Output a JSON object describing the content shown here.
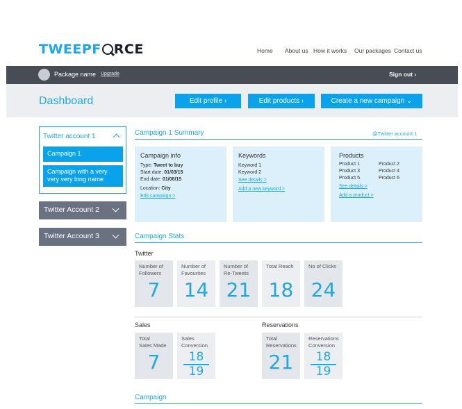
{
  "logo": {
    "part1": "TWEEPF",
    "part2": "RCE"
  },
  "topnav": [
    "Home",
    "About us",
    "How it works",
    "Our packages",
    "Contact us"
  ],
  "bar": {
    "package": "Package name",
    "upgrade": "Upgrade",
    "signout": "Sign out ›"
  },
  "header": {
    "title": "Dashboard",
    "edit_profile": "Edit profile ›",
    "edit_products": "Edit products ›",
    "create": "Create a new campaign ⌄"
  },
  "sidebar": {
    "account1": "Twitter account 1",
    "campaigns": [
      "Campaign 1",
      "Campaign with a very very very long name"
    ],
    "account2": "Twitter Account 2",
    "account3": "Twitter Account 3"
  },
  "summary": {
    "title": "Campaign 1 Summary",
    "account": "@Twitter account 1",
    "info": {
      "title": "Campaign info",
      "type_label": "Type:",
      "type": "Tweet to buy",
      "start_label": "Start date:",
      "start": "01/03/15",
      "end_label": "End date:",
      "end": "01/08/15",
      "loc_label": "Location:",
      "loc": "City",
      "edit": "Edit campaign >"
    },
    "keywords": {
      "title": "Keywords",
      "items": [
        "Keyword 1",
        "Keyword 2"
      ],
      "see": "See details >",
      "add": "Add a new keyword >"
    },
    "products": {
      "title": "Products",
      "col1": [
        "Product 1",
        "Product 3",
        "Product 5"
      ],
      "col2": [
        "Product 2",
        "Product 4",
        "Product 6"
      ],
      "see": "See details >",
      "add": "Add a product >"
    }
  },
  "stats": {
    "title": "Campaign Stats",
    "twitter": "Twitter",
    "twitter_items": [
      {
        "label": "Number of\nFollowers",
        "value": "7"
      },
      {
        "label": "Number of\nFavourites",
        "value": "14"
      },
      {
        "label": "Number of\nRe-Tweets",
        "value": "21"
      },
      {
        "label": "Total Reach",
        "value": "18"
      },
      {
        "label": "No of Clicks",
        "value": "24"
      }
    ],
    "sales": "Sales",
    "sales_made": {
      "label": "Total\nSales Made",
      "value": "7"
    },
    "sales_conv": {
      "label": "Sales\nConversion",
      "num": "18",
      "den": "19"
    },
    "reservations": "Reservations",
    "res_total": {
      "label": "Total\nReservations",
      "value": "21"
    },
    "res_conv": {
      "label": "Reservations\nConversion",
      "num": "18",
      "den": "19"
    }
  },
  "campaign_section": "Campaign"
}
